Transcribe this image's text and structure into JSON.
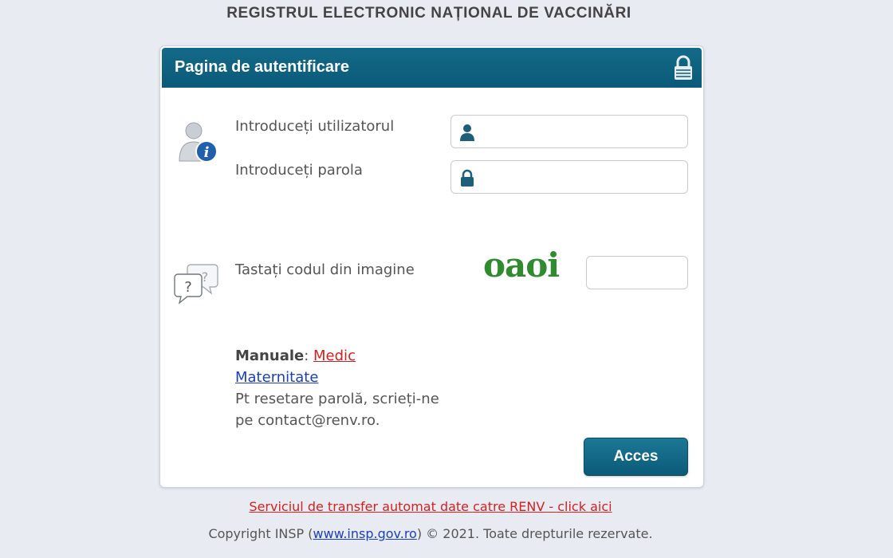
{
  "page": {
    "title": "REGISTRUL ELECTRONIC NAȚIONAL DE VACCINĂRI"
  },
  "panel": {
    "title": "Pagina de autentificare"
  },
  "form": {
    "username_label": "Introduceți utilizatorul",
    "username_value": "",
    "password_label": "Introduceți parola",
    "password_value": "",
    "captcha_label": "Tastați codul din imagine",
    "captcha_image_text": "oaoi",
    "captcha_value": ""
  },
  "manuals": {
    "label": "Manuale",
    "separator": ":",
    "link_medic": "Medic",
    "link_maternitate": "Maternitate",
    "reset_text": "Pt resetare parolă, scrieți-ne pe contact@renv.ro."
  },
  "buttons": {
    "acces": "Acces"
  },
  "footer": {
    "transfer_link": "Serviciul de transfer automat date catre RENV - click aici",
    "copyright_prefix": "Copyright INSP (",
    "copyright_link": "www.insp.gov.ro",
    "copyright_suffix": ") © 2021. Toate drepturile rezervate."
  },
  "colors": {
    "header": "#0a5a78",
    "button": "#0b5a78",
    "captcha": "#2e8b2e",
    "link_red": "#d62020",
    "link_blue": "#1a3fbf"
  },
  "icons": [
    "lock-icon",
    "user-info-icon",
    "help-bubbles-icon",
    "user-icon",
    "password-lock-icon"
  ]
}
